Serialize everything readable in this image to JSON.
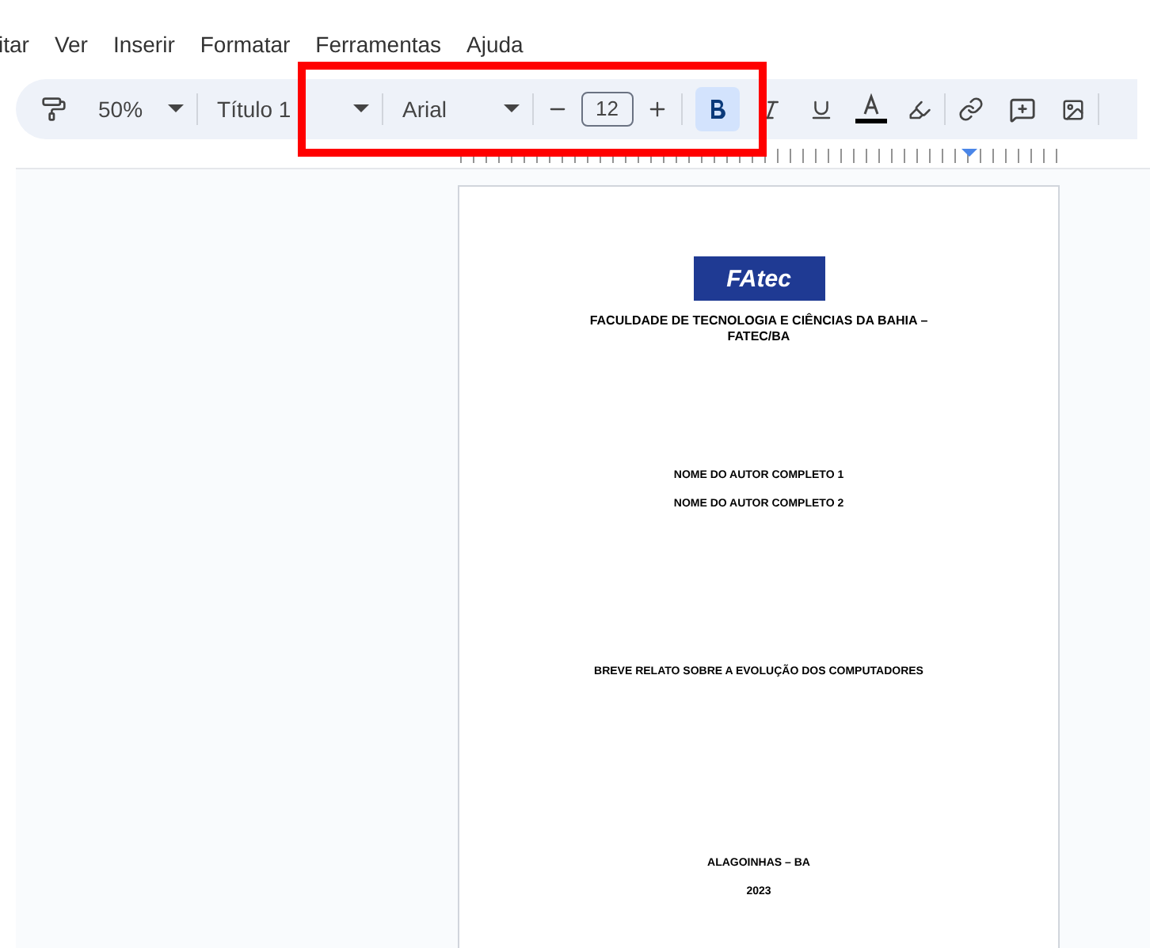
{
  "menu": [
    {
      "label": "itar"
    },
    {
      "label": "Ver"
    },
    {
      "label": "Inserir"
    },
    {
      "label": "Formatar"
    },
    {
      "label": "Ferramentas"
    },
    {
      "label": "Ajuda"
    }
  ],
  "toolbar": {
    "zoom": "50%",
    "style": "Título 1",
    "font": "Arial",
    "font_size": "12",
    "bold": true,
    "italic": false,
    "underline": false
  },
  "document": {
    "logo": "FAtec",
    "institution": "FACULDADE DE TECNOLOGIA E CIÊNCIAS DA BAHIA – FATEC/BA",
    "authors": [
      "NOME DO AUTOR COMPLETO 1",
      "NOME DO AUTOR COMPLETO 2"
    ],
    "title": "BREVE RELATO SOBRE A EVOLUÇÃO DOS COMPUTADORES",
    "city": "ALAGOINHAS – BA",
    "year": "2023"
  },
  "highlight": {
    "shown": true
  }
}
